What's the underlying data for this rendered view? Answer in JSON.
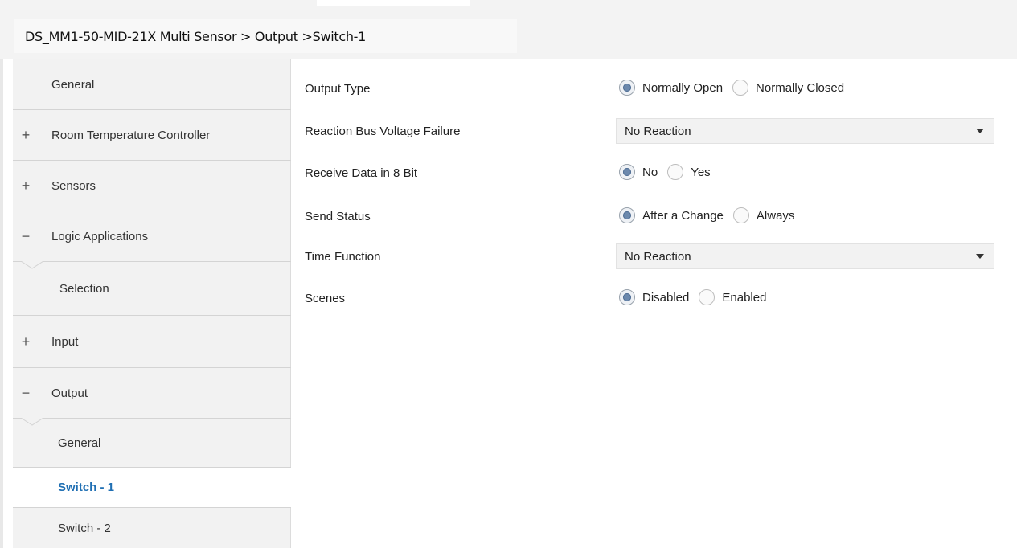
{
  "breadcrumb": "DS_MM1-50-MID-21X Multi Sensor > Output >Switch-1",
  "sidebar": {
    "items": [
      {
        "label": "General",
        "sign": ""
      },
      {
        "label": "Room Temperature Controller",
        "sign": "+"
      },
      {
        "label": "Sensors",
        "sign": "+"
      },
      {
        "label": "Logic Applications",
        "sign": "−"
      },
      {
        "label": "Selection",
        "sign": ""
      },
      {
        "label": "Input",
        "sign": "+"
      },
      {
        "label": "Output",
        "sign": "−"
      },
      {
        "label": "General",
        "sign": ""
      },
      {
        "label": "Switch - 1",
        "sign": "",
        "selected": true
      },
      {
        "label": "Switch - 2",
        "sign": ""
      }
    ]
  },
  "params": {
    "output_type": {
      "label": "Output Type",
      "options": [
        "Normally Open",
        "Normally Closed"
      ],
      "selected": "Normally Open"
    },
    "bus_voltage_failure": {
      "label": "Reaction Bus Voltage Failure",
      "value": "No Reaction"
    },
    "receive_8bit": {
      "label": "Receive Data in 8 Bit",
      "options": [
        "No",
        "Yes"
      ],
      "selected": "No"
    },
    "send_status": {
      "label": "Send Status",
      "options": [
        "After a Change",
        "Always"
      ],
      "selected": "After a Change"
    },
    "time_function": {
      "label": "Time Function",
      "value": "No Reaction"
    },
    "scenes": {
      "label": "Scenes",
      "options": [
        "Disabled",
        "Enabled"
      ],
      "selected": "Disabled"
    }
  },
  "colors": {
    "accent": "#1f6fb3",
    "radio_selected": "#6c89ad",
    "sidebar_bg": "#f2f2f2"
  }
}
